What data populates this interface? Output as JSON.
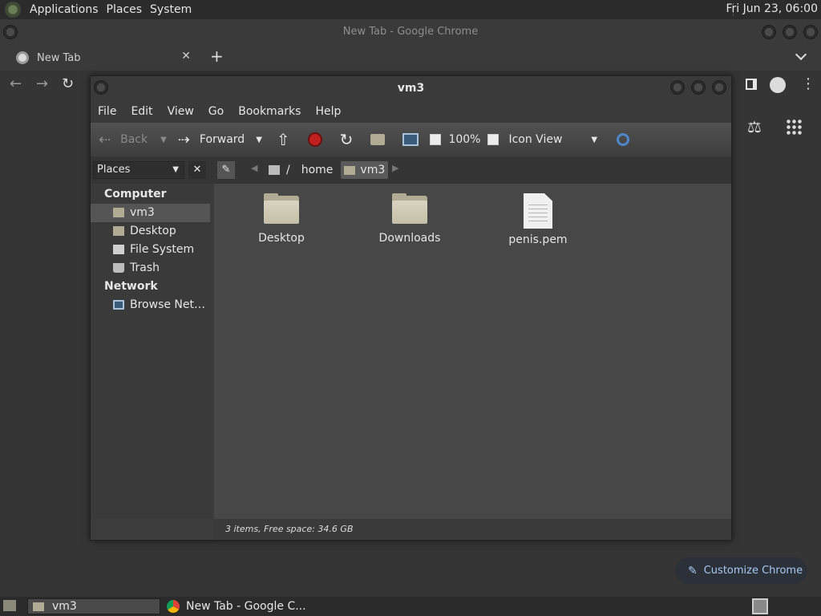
{
  "panel": {
    "menus": [
      "Applications",
      "Places",
      "System"
    ],
    "clock": "Fri Jun 23, 06:00"
  },
  "chrome": {
    "window_title": "New Tab - Google Chrome",
    "tab_title": "New Tab",
    "tab_close": "✕",
    "new_tab": "+",
    "customize_label": "Customize Chrome"
  },
  "fm": {
    "title": "vm3",
    "menubar": [
      "File",
      "Edit",
      "View",
      "Go",
      "Bookmarks",
      "Help"
    ],
    "toolbar": {
      "back": "Back",
      "forward": "Forward",
      "zoom": "100%",
      "view_mode": "Icon View"
    },
    "location": {
      "pane": "Places",
      "path": [
        "/",
        "home",
        "vm3"
      ]
    },
    "sidebar": {
      "computer_header": "Computer",
      "computer_items": [
        "vm3",
        "Desktop",
        "File System",
        "Trash"
      ],
      "network_header": "Network",
      "network_items": [
        "Browse Net…"
      ]
    },
    "files": [
      {
        "name": "Desktop",
        "kind": "folder"
      },
      {
        "name": "Downloads",
        "kind": "folder"
      },
      {
        "name": "penis.pem",
        "kind": "document"
      }
    ],
    "status": "3 items, Free space: 34.6 GB"
  },
  "taskbar": {
    "items": [
      "vm3",
      "New Tab - Google C..."
    ]
  }
}
